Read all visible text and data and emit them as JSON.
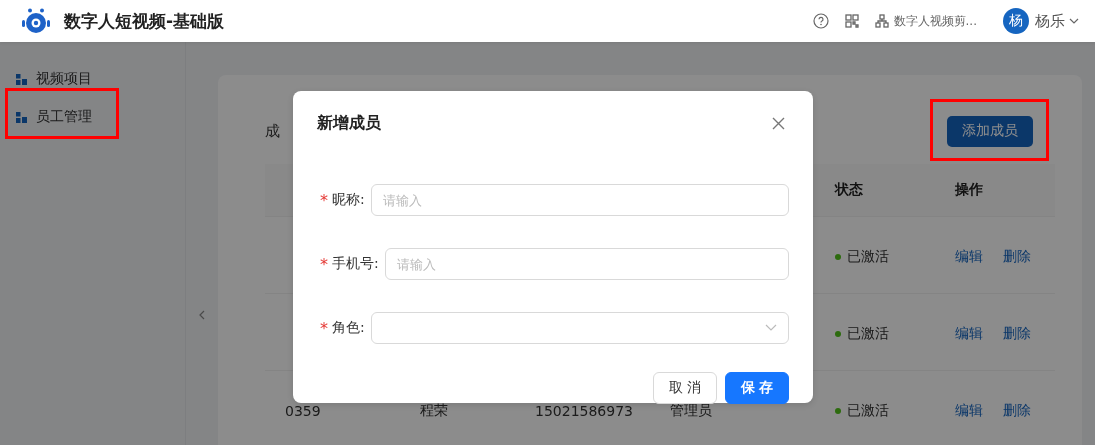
{
  "header": {
    "title": "数字人短视频-基础版",
    "org": "数字人视频剪...",
    "avatar": "杨",
    "user": "杨乐"
  },
  "sidebar": {
    "items": [
      {
        "label": "视频项目"
      },
      {
        "label": "员工管理"
      }
    ]
  },
  "page": {
    "title": "成",
    "add_button": "添加成员",
    "table": {
      "columns": [
        "状态",
        "操作"
      ],
      "rows": [
        {
          "cells": [],
          "status": "已激活",
          "actions": [
            "编辑",
            "删除"
          ]
        },
        {
          "cells": [],
          "status": "已激活",
          "actions": [
            "编辑",
            "删除"
          ]
        },
        {
          "cells": [
            "0359",
            "程荣",
            "15021586973",
            "管理员"
          ],
          "status": "已激活",
          "actions": [
            "编辑",
            "删除"
          ]
        }
      ]
    }
  },
  "dialog": {
    "title": "新增成员",
    "fields": [
      {
        "kind": "text",
        "mark": "*",
        "label": "昵称:",
        "placeholder": "请输入"
      },
      {
        "kind": "text",
        "mark": "*",
        "label": "手机号:",
        "placeholder": "请输入"
      },
      {
        "kind": "select",
        "mark": "*",
        "label": "角色:"
      }
    ],
    "buttons": [
      {
        "kind": "default",
        "label": "取 消"
      },
      {
        "kind": "primary",
        "label": "保 存"
      }
    ]
  }
}
